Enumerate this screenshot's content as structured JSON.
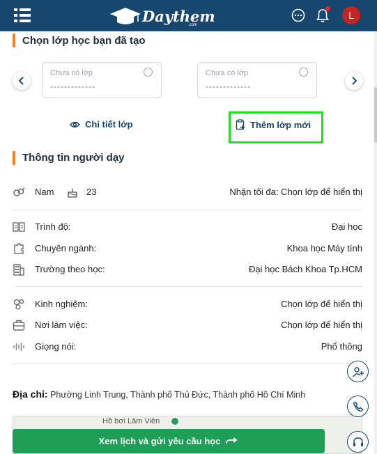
{
  "header": {
    "logo_text": "Daythem",
    "logo_sub": ".com",
    "avatar_initial": "L"
  },
  "class_section": {
    "title": "Chọn lớp học bạn đã tạo",
    "cards": [
      {
        "placeholder": "Chưa có lớp",
        "value": "-------------"
      },
      {
        "placeholder": "Chưa có lớp",
        "value": "-------------"
      }
    ],
    "detail_link": "Chi tiết lớp",
    "add_class_link": "Thêm lớp mới"
  },
  "tutor_section": {
    "title": "Thông tin người dạy",
    "gender": "Nam",
    "age": "23",
    "max_students": "Nhận tối đa: Chọn lớp để hiển thị",
    "education_rows": [
      {
        "label": "Trình độ:",
        "value": "Đại học",
        "icon": "book-icon"
      },
      {
        "label": "Chuyên ngành:",
        "value": "Khoa học Máy tính",
        "icon": "puzzle-icon"
      },
      {
        "label": "Trường theo học:",
        "value": "Đại học Bách Khoa Tp.HCM",
        "icon": "building-icon"
      }
    ],
    "experience_rows": [
      {
        "label": "Kinh nghiệm:",
        "value": "Chọn lớp để hiển thị",
        "icon": "experience-icon"
      },
      {
        "label": "Nơi làm việc:",
        "value": "Chọn lớp để hiển thị",
        "icon": "briefcase-icon"
      },
      {
        "label": "Giọng nói:",
        "value": "Phổ thông",
        "icon": "voice-icon"
      }
    ]
  },
  "address": {
    "label": "Địa chỉ:",
    "value": "Phường Linh Trung, Thành phố Thủ Đức, Thành phố Hồ Chí Minh"
  },
  "map": {
    "place_label": "Hồ bơi Lâm Viên"
  },
  "cta": {
    "label": "Xem lịch và gửi yêu cầu học"
  },
  "colors": {
    "header_bg": "#17466f",
    "accent_orange": "#f58220",
    "cta_green": "#1e9e57",
    "highlight_green": "#22dd22",
    "avatar_red": "#c3251f"
  }
}
